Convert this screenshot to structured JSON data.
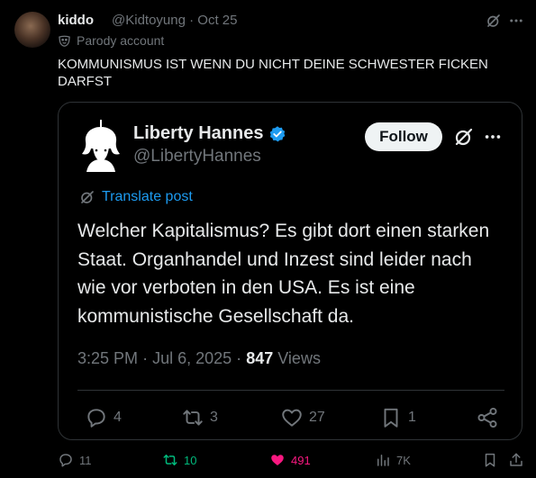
{
  "tweet": {
    "author_name": "kiddo",
    "author_handle": "@Kidtoyung",
    "separator": "·",
    "date": "Oct 25",
    "parody_label": "Parody account",
    "text": "KOMMUNISMUS IST WENN DU NICHT DEINE SCHWESTER FICKEN DARFST",
    "actions": {
      "replies": "11",
      "retweets": "10",
      "likes": "491",
      "views": "7K"
    }
  },
  "quote": {
    "author_name": "Liberty Hannes",
    "author_handle": "@LibertyHannes",
    "follow_label": "Follow",
    "translate_label": "Translate post",
    "text": "Welcher Kapitalismus? Es gibt dort einen starken Staat. Organhandel und Inzest sind leider nach wie vor verboten in den USA. Es ist eine kommunistische Gesellschaft da.",
    "time": "3:25 PM",
    "separator": "·",
    "date": "Jul 6, 2025",
    "separator2": "·",
    "views_count": "847",
    "views_label": "Views",
    "actions": {
      "replies": "4",
      "retweets": "3",
      "likes": "27",
      "bookmarks": "1"
    }
  },
  "colors": {
    "background": "#000000",
    "text": "#e7e9ea",
    "muted": "#71767b",
    "accent": "#1d9bf0",
    "retweet": "#00ba7c",
    "like": "#f91880"
  },
  "icons": [
    "grok-icon",
    "more-icon",
    "parody-mask-icon",
    "verified-badge-icon",
    "translate-icon",
    "reply-icon",
    "retweet-icon",
    "like-icon",
    "bookmark-icon",
    "share-icon",
    "views-icon"
  ]
}
